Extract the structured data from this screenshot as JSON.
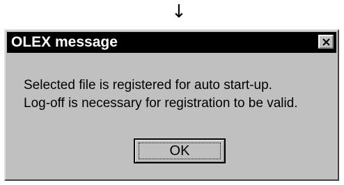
{
  "pointer": {
    "glyph": "↓",
    "icon": "down-arrow-icon"
  },
  "dialog": {
    "title": "OLEX message",
    "close_icon": "close-icon",
    "message_lines": [
      "Selected file is registered for auto start-up.",
      "Log-off is necessary for registration to be valid."
    ],
    "ok_label": "OK"
  },
  "colors": {
    "titlebar": "#000000",
    "title_text": "#ffffff",
    "dialog_face": "#c0c0c0"
  }
}
